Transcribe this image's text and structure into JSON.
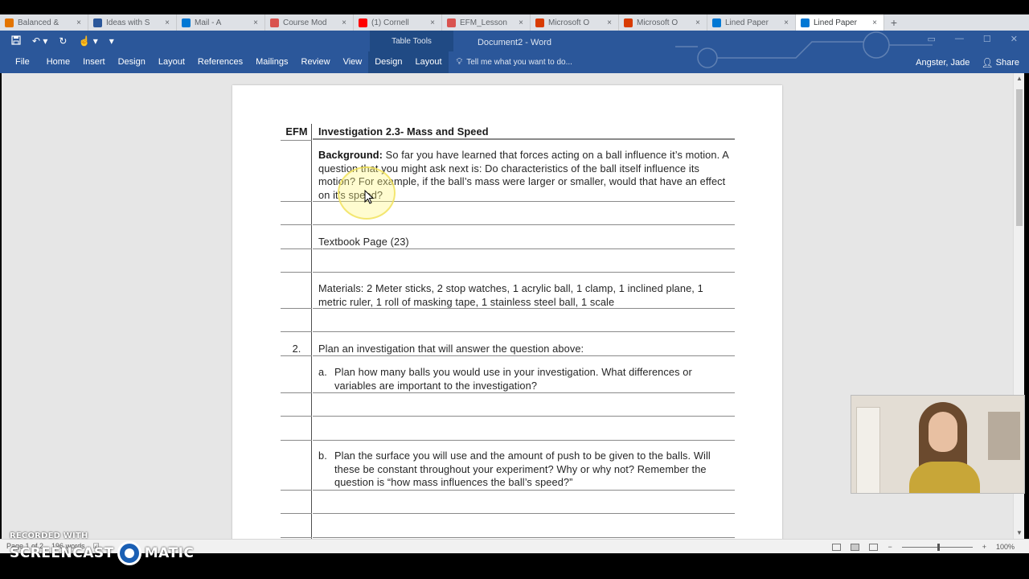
{
  "browser": {
    "tabs": [
      {
        "label": "Balanced &",
        "color": "#e37400"
      },
      {
        "label": "Ideas with S",
        "color": "#2b579a"
      },
      {
        "label": "Mail - A",
        "color": "#0078d4"
      },
      {
        "label": "Course Mod",
        "color": "#d9534f"
      },
      {
        "label": "(1) Cornell",
        "color": "#ff0000"
      },
      {
        "label": "EFM_Lesson",
        "color": "#d9534f"
      },
      {
        "label": "Microsoft O",
        "color": "#d83b01"
      },
      {
        "label": "Microsoft O",
        "color": "#d83b01"
      },
      {
        "label": "Lined Paper",
        "color": "#0078d4"
      },
      {
        "label": "Lined Paper",
        "color": "#0078d4",
        "active": true
      }
    ],
    "close_glyph": "×",
    "new_tab_glyph": "+"
  },
  "word": {
    "table_tools_label": "Table Tools",
    "doc_title": "Document2 - Word",
    "menu": {
      "file": "File",
      "home": "Home",
      "insert": "Insert",
      "design": "Design",
      "layout": "Layout",
      "references": "References",
      "mailings": "Mailings",
      "review": "Review",
      "view": "View",
      "table_design": "Design",
      "table_layout": "Layout"
    },
    "tell_me": "Tell me what you want to do...",
    "user_name": "Angster, Jade",
    "share": "Share",
    "ribbon_color": "#2b579a"
  },
  "document": {
    "header": {
      "left": "EFM",
      "title": "Investigation 2.3- Mass and Speed"
    },
    "background_label": "Background:",
    "background_text": " So far you have learned that forces acting on a ball influence it’s motion. A question that you might ask next is: Do characteristics of the ball itself influence its motion? For example, if the ball’s mass were larger or smaller, would that have an effect on it’s speed?",
    "textbook": "Textbook Page (23)",
    "materials": "Materials: 2 Meter sticks, 2 stop watches, 1 acrylic ball, 1 clamp, 1 inclined plane, 1 metric ruler, 1 roll of masking tape, 1 stainless steel ball, 1 scale",
    "item2_number": "2.",
    "item2_text": "Plan an investigation that will answer the question above:",
    "item_a_letter": "a.",
    "item_a_text": "Plan how many balls you would use in your investigation. What differences or variables are important to the investigation?",
    "item_b_letter": "b.",
    "item_b_text": "Plan the surface you will use and the amount of push to be given to the balls. Will these be constant throughout your experiment? Why or why not? Remember the question is “how mass influences the ball’s speed?”"
  },
  "status": {
    "page": "Page 1 of 2",
    "words": "196 words",
    "zoom_minus": "−",
    "zoom_plus": "+",
    "zoom": "100%"
  },
  "watermark": {
    "top": "RECORDED WITH",
    "left": "SCREENCAST",
    "right": "MATIC"
  }
}
